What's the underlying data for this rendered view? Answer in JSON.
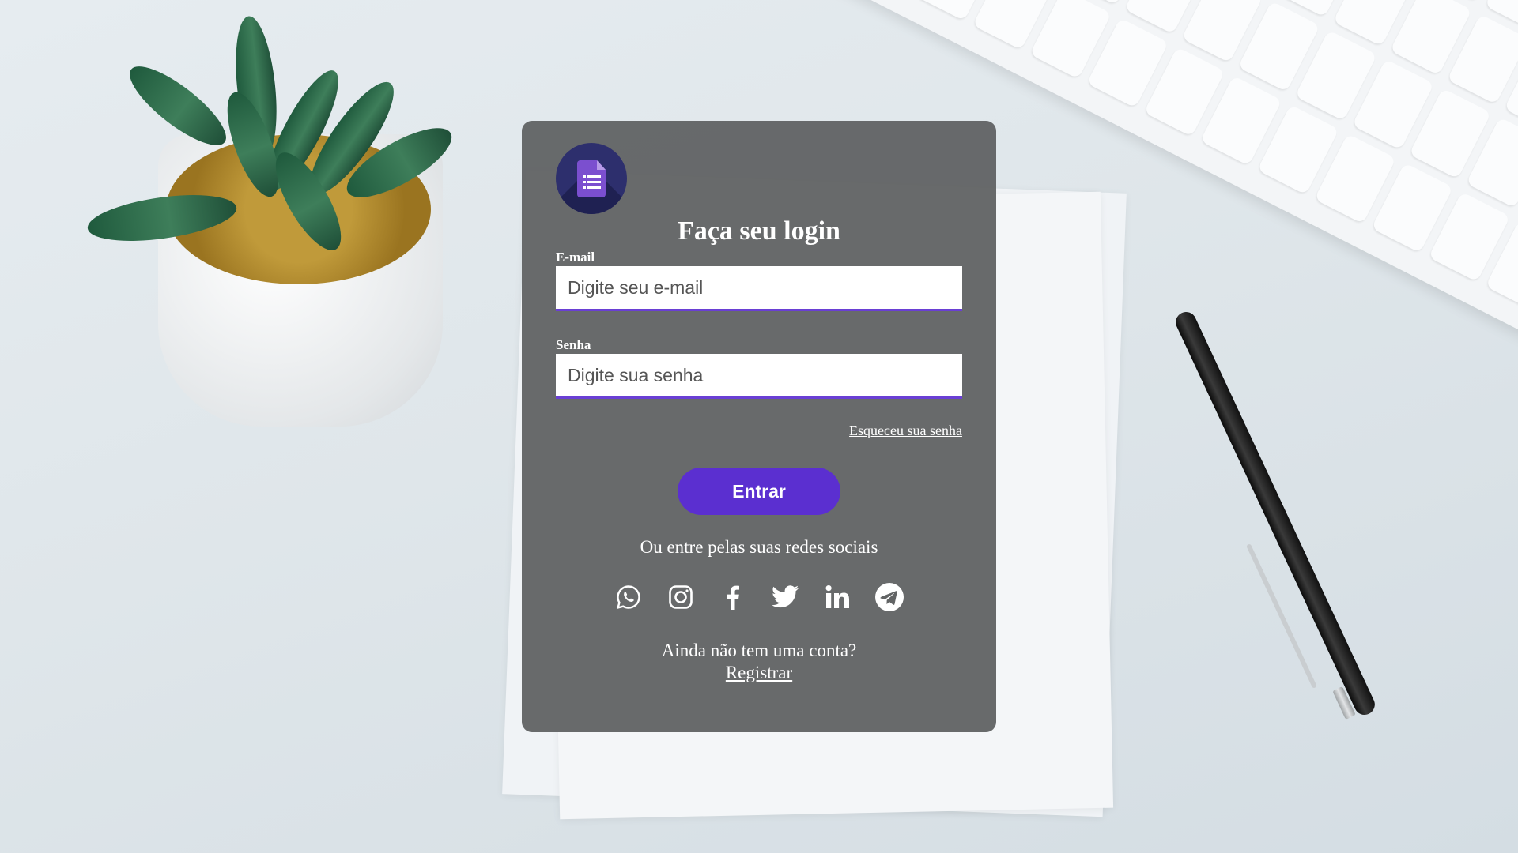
{
  "login": {
    "title": "Faça seu login",
    "email_label": "E-mail",
    "email_placeholder": "Digite seu e-mail",
    "email_value": "",
    "password_label": "Senha",
    "password_placeholder": "Digite sua senha",
    "password_value": "",
    "forgot_link": "Esqueceu sua senha",
    "submit_label": "Entrar",
    "social_text": "Ou entre pelas suas redes sociais",
    "social_icons": [
      "whatsapp-icon",
      "instagram-icon",
      "facebook-icon",
      "twitter-icon",
      "linkedin-icon",
      "telegram-icon"
    ],
    "no_account_text": "Ainda não tem uma conta?",
    "register_link": "Registrar"
  },
  "logo": {
    "icon": "forms-document-icon"
  },
  "colors": {
    "card_background": "#626465",
    "accent": "#5b2fd0",
    "text": "#ffffff",
    "input_underline": "#6a3fd4"
  }
}
